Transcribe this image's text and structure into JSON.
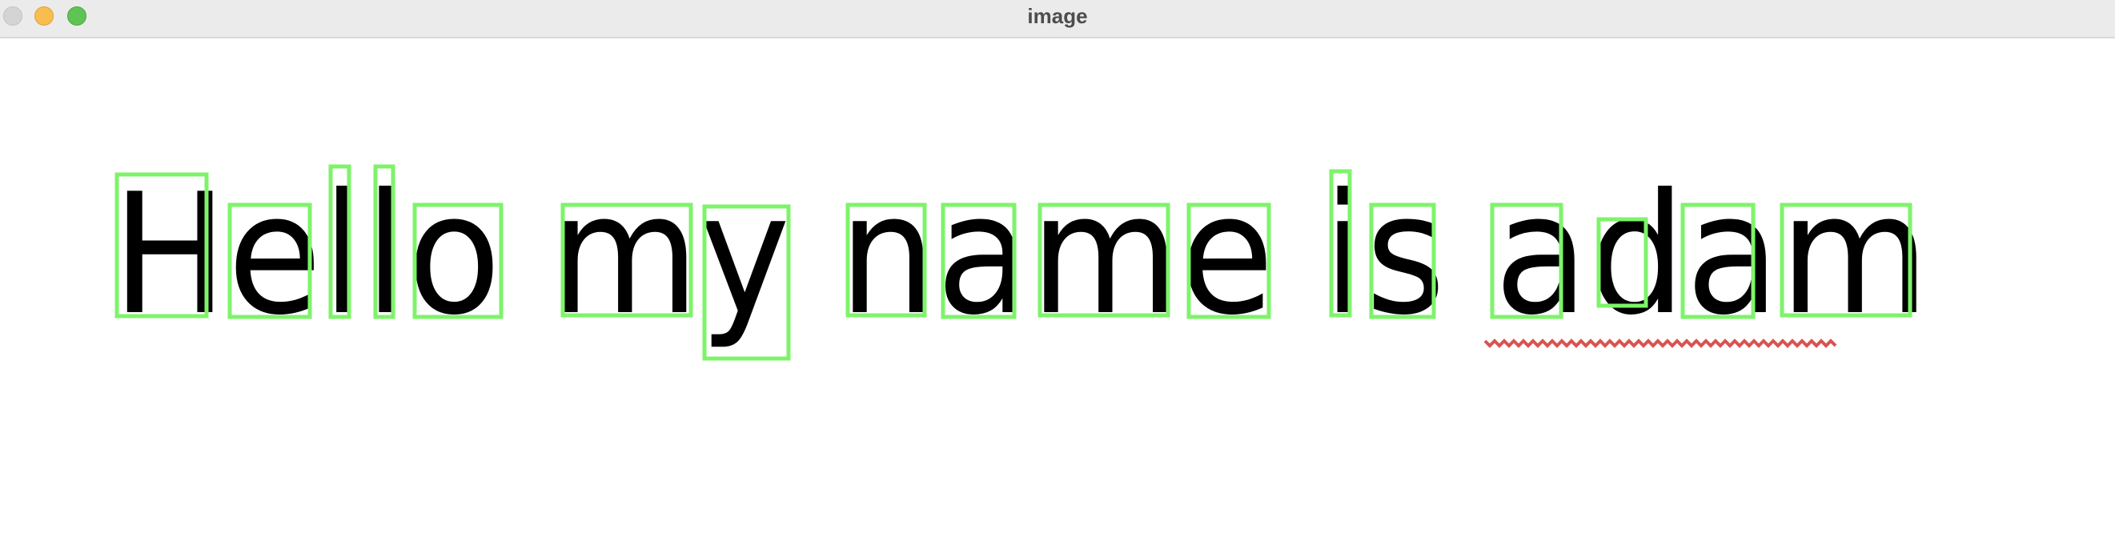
{
  "window": {
    "title": "image"
  },
  "image": {
    "sentence": "Hello my name is adam",
    "box_color": "#7ef36a",
    "spellcheck_underline_color": "#d9534f",
    "misspelled_word": "adam"
  }
}
